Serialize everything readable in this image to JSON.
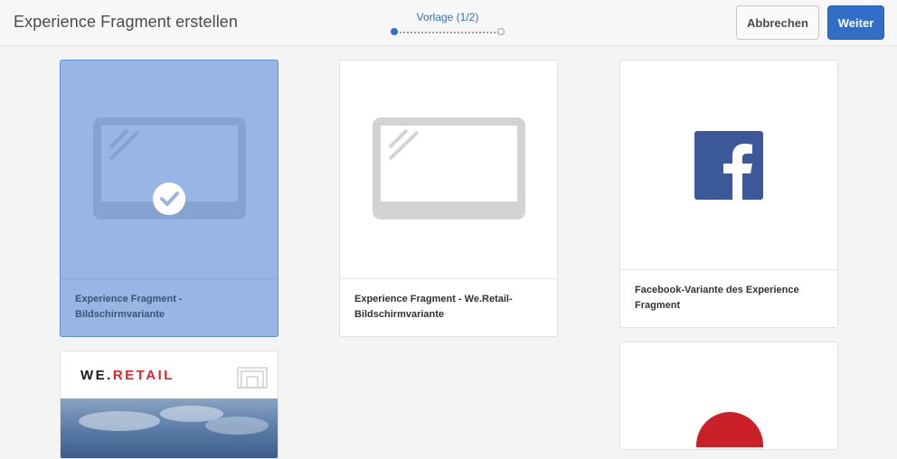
{
  "header": {
    "title": "Experience Fragment erstellen",
    "step_label": "Vorlage (1/2)",
    "cancel_label": "Abbrechen",
    "next_label": "Weiter"
  },
  "templates": [
    {
      "title": "Experience Fragment - Bildschirmvariante",
      "selected": true,
      "icon": "screen-icon"
    },
    {
      "title": "Experience Fragment - We.Retail-Bildschirmvariante",
      "selected": false,
      "icon": "screen-icon"
    },
    {
      "title": "Facebook-Variante des Experience Fragment",
      "selected": false,
      "icon": "facebook-icon"
    },
    {
      "title": "",
      "selected": false,
      "icon": "we-retail-logo",
      "logo_text_dark": "WE.",
      "logo_text_red": "RETAIL"
    },
    {
      "title": "",
      "selected": false,
      "icon": "pinterest-icon"
    }
  ],
  "colors": {
    "accent": "#326ec8",
    "selected_card": "#97b6e4",
    "facebook": "#3b5998",
    "we_retail_red": "#e0242b",
    "pinterest": "#cb2027"
  }
}
